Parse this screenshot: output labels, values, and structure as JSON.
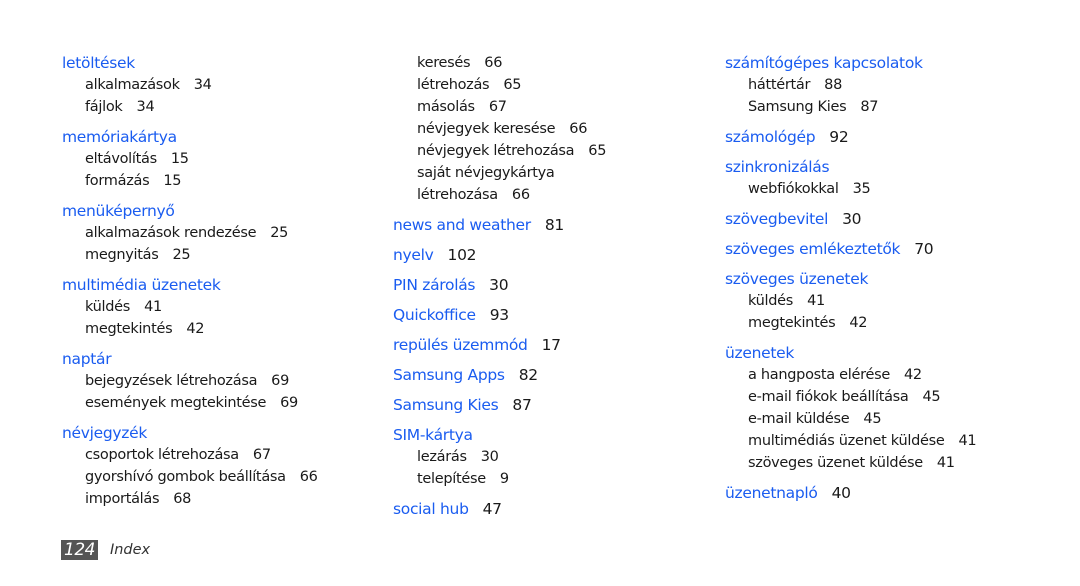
{
  "colors": {
    "heading": "#1a5cf0",
    "text": "#1a1a1a",
    "page_badge": "#555555"
  },
  "columns": [
    {
      "entries": [
        {
          "term": "letöltések",
          "page": "",
          "subs": [
            {
              "term": "alkalmazások",
              "page": "34"
            },
            {
              "term": "fájlok",
              "page": "34"
            }
          ]
        },
        {
          "term": "memóriakártya",
          "page": "",
          "subs": [
            {
              "term": "eltávolítás",
              "page": "15"
            },
            {
              "term": "formázás",
              "page": "15"
            }
          ]
        },
        {
          "term": "menüképernyő",
          "page": "",
          "subs": [
            {
              "term": "alkalmazások rendezése",
              "page": "25"
            },
            {
              "term": "megnyitás",
              "page": "25"
            }
          ]
        },
        {
          "term": "multimédia üzenetek",
          "page": "",
          "subs": [
            {
              "term": "küldés",
              "page": "41"
            },
            {
              "term": "megtekintés",
              "page": "42"
            }
          ]
        },
        {
          "term": "naptár",
          "page": "",
          "subs": [
            {
              "term": "bejegyzések létrehozása",
              "page": "69"
            },
            {
              "term": "események megtekintése",
              "page": "69"
            }
          ]
        },
        {
          "term": "névjegyzék",
          "page": "",
          "subs": [
            {
              "term": "csoportok létrehozása",
              "page": "67"
            },
            {
              "term": "gyorshívó gombok beállítása",
              "page": "66"
            },
            {
              "term": "importálás",
              "page": "68"
            }
          ]
        }
      ]
    },
    {
      "continued": [
        {
          "term": "keresés",
          "page": "66"
        },
        {
          "term": "létrehozás",
          "page": "65"
        },
        {
          "term": "másolás",
          "page": "67"
        },
        {
          "term": "névjegyek keresése",
          "page": "66"
        },
        {
          "term": "névjegyek létrehozása",
          "page": "65"
        },
        {
          "term": "saját névjegykártya",
          "page": ""
        },
        {
          "term": "létrehozása",
          "page": "66"
        }
      ],
      "entries": [
        {
          "term": "news and weather",
          "page": "81",
          "subs": []
        },
        {
          "term": "nyelv",
          "page": "102",
          "subs": []
        },
        {
          "term": "PIN zárolás",
          "page": "30",
          "subs": []
        },
        {
          "term": "Quickoffice",
          "page": "93",
          "subs": []
        },
        {
          "term": "repülés üzemmód",
          "page": "17",
          "subs": []
        },
        {
          "term": "Samsung Apps",
          "page": "82",
          "subs": []
        },
        {
          "term": "Samsung Kies",
          "page": "87",
          "subs": []
        },
        {
          "term": "SIM-kártya",
          "page": "",
          "subs": [
            {
              "term": "lezárás",
              "page": "30"
            },
            {
              "term": "telepítése",
              "page": "9"
            }
          ]
        },
        {
          "term": "social hub",
          "page": "47",
          "subs": []
        }
      ]
    },
    {
      "entries": [
        {
          "term": "számítógépes kapcsolatok",
          "page": "",
          "subs": [
            {
              "term": "háttértár",
              "page": "88"
            },
            {
              "term": "Samsung Kies",
              "page": "87"
            }
          ]
        },
        {
          "term": "számológép",
          "page": "92",
          "subs": []
        },
        {
          "term": "szinkronizálás",
          "page": "",
          "subs": [
            {
              "term": "webfiókokkal",
              "page": "35"
            }
          ]
        },
        {
          "term": "szövegbevitel",
          "page": "30",
          "subs": []
        },
        {
          "term": "szöveges emlékeztetők",
          "page": "70",
          "subs": []
        },
        {
          "term": "szöveges üzenetek",
          "page": "",
          "subs": [
            {
              "term": "küldés",
              "page": "41"
            },
            {
              "term": "megtekintés",
              "page": "42"
            }
          ]
        },
        {
          "term": "üzenetek",
          "page": "",
          "subs": [
            {
              "term": "a hangposta elérése",
              "page": "42"
            },
            {
              "term": "e-mail fiókok beállítása",
              "page": "45"
            },
            {
              "term": "e-mail küldése",
              "page": "45"
            },
            {
              "term": "multimédiás üzenet küldése",
              "page": "41"
            },
            {
              "term": "szöveges üzenet küldése",
              "page": "41"
            }
          ]
        },
        {
          "term": "üzenetnapló",
          "page": "40",
          "subs": []
        }
      ]
    }
  ],
  "footer": {
    "page_number": "124",
    "section": "Index"
  }
}
